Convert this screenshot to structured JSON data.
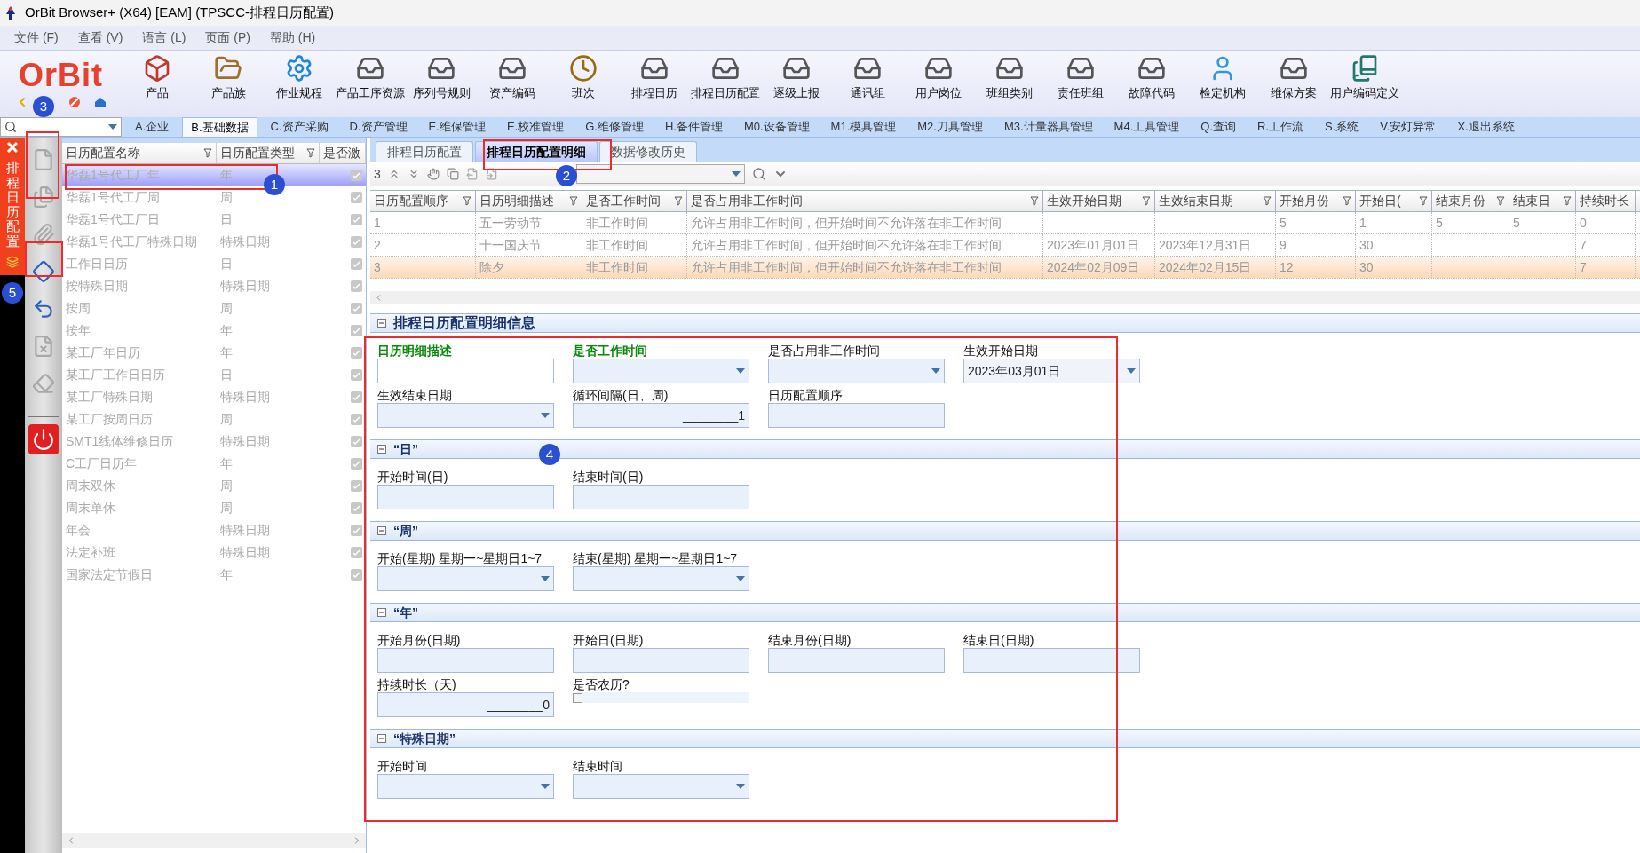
{
  "window": {
    "title": "OrBit Browser+ (X64) [EAM] (TPSCC-排程日历配置)"
  },
  "menu": [
    "文件 (F)",
    "查看 (V)",
    "语言 (L)",
    "页面 (P)",
    "帮助 (H)"
  ],
  "logo": "OrBit",
  "toolbar": [
    {
      "label": "产品",
      "kind": "cube"
    },
    {
      "label": "产品族",
      "kind": "folder"
    },
    {
      "label": "作业规程",
      "kind": "gear"
    },
    {
      "label": "产品工序资源",
      "kind": "tray"
    },
    {
      "label": "序列号规则",
      "kind": "tray"
    },
    {
      "label": "资产编码",
      "kind": "tray"
    },
    {
      "label": "班次",
      "kind": "clock"
    },
    {
      "label": "排程日历",
      "kind": "tray"
    },
    {
      "label": "排程日历配置",
      "kind": "tray"
    },
    {
      "label": "逐级上报",
      "kind": "tray"
    },
    {
      "label": "通讯组",
      "kind": "tray"
    },
    {
      "label": "用户岗位",
      "kind": "tray"
    },
    {
      "label": "班组类别",
      "kind": "tray"
    },
    {
      "label": "责任班组",
      "kind": "tray"
    },
    {
      "label": "故障代码",
      "kind": "tray"
    },
    {
      "label": "检定机构",
      "kind": "person"
    },
    {
      "label": "维保方案",
      "kind": "tray"
    },
    {
      "label": "用户编码定义",
      "kind": "books"
    }
  ],
  "module_tabs": [
    {
      "label": "A.企业",
      "selected": false
    },
    {
      "label": "B.基础数据",
      "selected": true
    },
    {
      "label": "C.资产采购",
      "selected": false
    },
    {
      "label": "D.资产管理",
      "selected": false
    },
    {
      "label": "E.维保管理",
      "selected": false
    },
    {
      "label": "E.校准管理",
      "selected": false
    },
    {
      "label": "G.维修管理",
      "selected": false
    },
    {
      "label": "H.备件管理",
      "selected": false
    },
    {
      "label": "M0.设备管理",
      "selected": false
    },
    {
      "label": "M1.模具管理",
      "selected": false
    },
    {
      "label": "M2.刀具管理",
      "selected": false
    },
    {
      "label": "M3.计量器具管理",
      "selected": false
    },
    {
      "label": "M4.工具管理",
      "selected": false
    },
    {
      "label": "Q.查询",
      "selected": false
    },
    {
      "label": "R.工作流",
      "selected": false
    },
    {
      "label": "S.系统",
      "selected": false
    },
    {
      "label": "V.安灯异常",
      "selected": false
    },
    {
      "label": "X.退出系统",
      "selected": false
    }
  ],
  "side_tab": {
    "label": "排程日历配置"
  },
  "tools": [
    {
      "kind": "page",
      "disabled": true
    },
    {
      "kind": "pages",
      "disabled": true
    },
    {
      "kind": "clip",
      "disabled": true
    },
    {
      "kind": "save",
      "disabled": false
    },
    {
      "kind": "undo",
      "disabled": false
    },
    {
      "kind": "delete",
      "disabled": true
    },
    {
      "kind": "erase",
      "disabled": true
    },
    {
      "kind": "exit",
      "disabled": false
    }
  ],
  "list": {
    "columns": [
      "日历配置名称",
      "日历配置类型",
      "是否激"
    ],
    "rows": [
      {
        "name": "华磊1号代工厂年",
        "type": "年",
        "active": true,
        "selected": true
      },
      {
        "name": "华磊1号代工厂周",
        "type": "周",
        "active": true,
        "selected": false
      },
      {
        "name": "华磊1号代工厂日",
        "type": "日",
        "active": true,
        "selected": false
      },
      {
        "name": "华磊1号代工厂特殊日期",
        "type": "特殊日期",
        "active": true,
        "selected": false
      },
      {
        "name": "工作日日历",
        "type": "日",
        "active": true,
        "selected": false
      },
      {
        "name": "按特殊日期",
        "type": "特殊日期",
        "active": true,
        "selected": false
      },
      {
        "name": "按周",
        "type": "周",
        "active": true,
        "selected": false
      },
      {
        "name": "按年",
        "type": "年",
        "active": true,
        "selected": false
      },
      {
        "name": "某工厂年日历",
        "type": "年",
        "active": true,
        "selected": false
      },
      {
        "name": "某工厂工作日日历",
        "type": "日",
        "active": true,
        "selected": false
      },
      {
        "name": "某工厂特殊日期",
        "type": "特殊日期",
        "active": true,
        "selected": false
      },
      {
        "name": "某工厂按周日历",
        "type": "周",
        "active": true,
        "selected": false
      },
      {
        "name": "SMT1线体维修日历",
        "type": "特殊日期",
        "active": true,
        "selected": false
      },
      {
        "name": "C工厂日历年",
        "type": "年",
        "active": true,
        "selected": false
      },
      {
        "name": "周末双休",
        "type": "周",
        "active": true,
        "selected": false
      },
      {
        "name": "周末单休",
        "type": "周",
        "active": true,
        "selected": false
      },
      {
        "name": "年会",
        "type": "特殊日期",
        "active": true,
        "selected": false
      },
      {
        "name": "法定补班",
        "type": "特殊日期",
        "active": true,
        "selected": false
      },
      {
        "name": "国家法定节假日",
        "type": "年",
        "active": true,
        "selected": false
      }
    ]
  },
  "detail_tabs": [
    {
      "label": "排程日历配置",
      "selected": false
    },
    {
      "label": "排程日历配置明细",
      "selected": true
    },
    {
      "label": "数据修改历史",
      "selected": false
    }
  ],
  "grid_toolbar": {
    "count": "3"
  },
  "grid": {
    "columns": [
      "日历配置顺序",
      "日历明细描述",
      "是否工作时间",
      "是否占用非工作时间",
      "生效开始日期",
      "生效结束日期",
      "开始月份",
      "开始日(",
      "结束月份",
      "结束日",
      "持续时长"
    ],
    "rows": [
      {
        "selected": false,
        "cells": [
          "1",
          "五一劳动节",
          "非工作时间",
          "允许占用非工作时间，但开始时间不允许落在非工作时间",
          "",
          "",
          "5",
          "1",
          "5",
          "5",
          "0"
        ]
      },
      {
        "selected": false,
        "cells": [
          "2",
          "十一国庆节",
          "非工作时间",
          "允许占用非工作时间，但开始时间不允许落在非工作时间",
          "2023年01月01日",
          "2023年12月31日",
          "9",
          "30",
          "",
          "",
          "7"
        ]
      },
      {
        "selected": true,
        "cells": [
          "3",
          "除夕",
          "非工作时间",
          "允许占用非工作时间，但开始时间不允许落在非工作时间",
          "2024年02月09日",
          "2024年02月15日",
          "12",
          "30",
          "",
          "",
          "7"
        ]
      }
    ]
  },
  "form": {
    "title": "排程日历配置明细信息",
    "expanded": true,
    "fields": [
      {
        "label": "日历明细描述",
        "kind": "text",
        "required": true
      },
      {
        "label": "是否工作时间",
        "kind": "dropdown",
        "required": true
      },
      {
        "label": "是否占用非工作时间",
        "kind": "dropdown",
        "required": false
      },
      {
        "label": "生效开始日期",
        "kind": "dropdown",
        "required": false,
        "value": "2023年03月01日"
      },
      {
        "label": "生效结束日期",
        "kind": "dropdown",
        "required": false
      },
      {
        "label": "循环间隔(日、周)",
        "kind": "number",
        "required": false,
        "value": "________1"
      },
      {
        "label": "日历配置顺序",
        "kind": "text",
        "required": false
      }
    ],
    "sections": [
      {
        "title": "“日”",
        "expanded": true,
        "fields": [
          {
            "label": "开始时间(日)",
            "kind": "text",
            "required": false
          },
          {
            "label": "结束时间(日)",
            "kind": "text",
            "required": false
          }
        ]
      },
      {
        "title": "“周”",
        "expanded": true,
        "fields": [
          {
            "label": "开始(星期) 星期一~星期日1~7",
            "kind": "dropdown",
            "required": false
          },
          {
            "label": "结束(星期) 星期一~星期日1~7",
            "kind": "dropdown",
            "required": false
          }
        ]
      },
      {
        "title": "“年”",
        "expanded": true,
        "fields": [
          {
            "label": "开始月份(日期)",
            "kind": "text",
            "required": false
          },
          {
            "label": "开始日(日期)",
            "kind": "text",
            "required": false
          },
          {
            "label": "结束月份(日期)",
            "kind": "text",
            "required": false
          },
          {
            "label": "结束日(日期)",
            "kind": "text",
            "required": false
          },
          {
            "label": "持续时长（天)",
            "kind": "number",
            "required": false,
            "value": "________0"
          },
          {
            "label": "是否农历?",
            "kind": "checkbox",
            "required": false,
            "checked": false
          }
        ]
      },
      {
        "title": "“特殊日期”",
        "expanded": true,
        "fields": [
          {
            "label": "开始时间",
            "kind": "dropdown",
            "required": false
          },
          {
            "label": "结束时间",
            "kind": "dropdown",
            "required": false
          }
        ]
      }
    ]
  },
  "annotations": [
    "1",
    "2",
    "3",
    "4",
    "5"
  ]
}
